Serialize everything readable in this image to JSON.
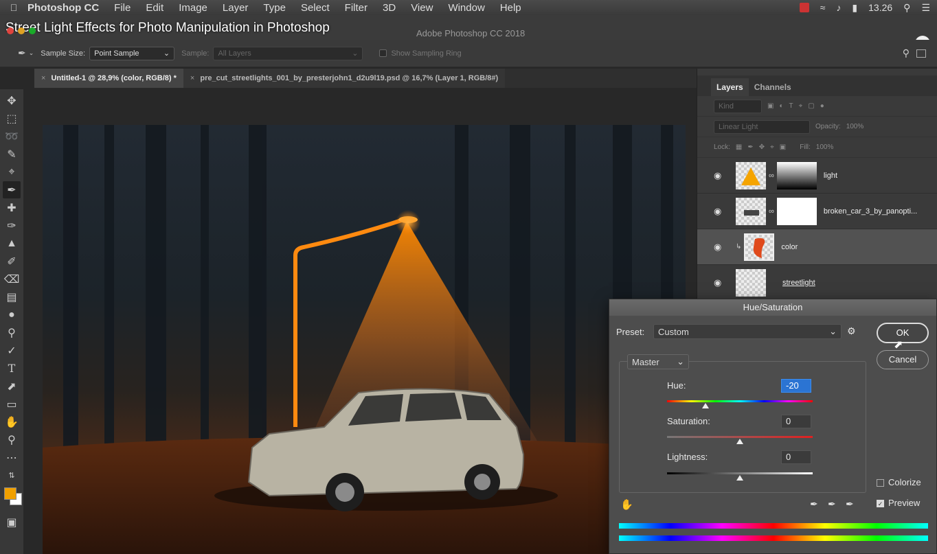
{
  "menubar": {
    "app_name": "Photoshop CC",
    "items": [
      "File",
      "Edit",
      "Image",
      "Layer",
      "Type",
      "Select",
      "Filter",
      "3D",
      "View",
      "Window",
      "Help"
    ],
    "time": "13.26"
  },
  "video_title": "Street Light Effects for Photo Manipulation in Photoshop",
  "window_title": "Adobe Photoshop CC 2018",
  "options": {
    "sample_size_label": "Sample Size:",
    "sample_size_value": "Point Sample",
    "sample_label": "Sample:",
    "sample_value": "All Layers",
    "show_ring_label": "Show Sampling Ring"
  },
  "tabs": [
    {
      "label": "Untitled-1 @ 28,9% (color, RGB/8) *"
    },
    {
      "label": "pre_cut_streetlights_001_by_presterjohn1_d2u9l19.psd @ 16,7% (Layer 1, RGB/8#)"
    }
  ],
  "layers_panel": {
    "tabs": [
      "Layers",
      "Channels"
    ],
    "kind_label": "Kind",
    "blend_mode": "Linear Light",
    "opacity_label": "Opacity:",
    "opacity_value": "100%",
    "lock_label": "Lock:",
    "fill_label": "Fill:",
    "fill_value": "100%",
    "layers": [
      {
        "name": "light"
      },
      {
        "name": "broken_car_3_by_panopti..."
      },
      {
        "name": "color"
      },
      {
        "name": "streetlight"
      }
    ]
  },
  "huesat": {
    "title": "Hue/Saturation",
    "preset_label": "Preset:",
    "preset_value": "Custom",
    "channel": "Master",
    "hue_label": "Hue:",
    "hue_value": "-20",
    "saturation_label": "Saturation:",
    "saturation_value": "0",
    "lightness_label": "Lightness:",
    "lightness_value": "0",
    "ok_label": "OK",
    "cancel_label": "Cancel",
    "colorize_label": "Colorize",
    "preview_label": "Preview"
  },
  "colors": {
    "foreground": "#f0a000",
    "background": "#ffffff",
    "light_orange": "#ff8a00"
  }
}
